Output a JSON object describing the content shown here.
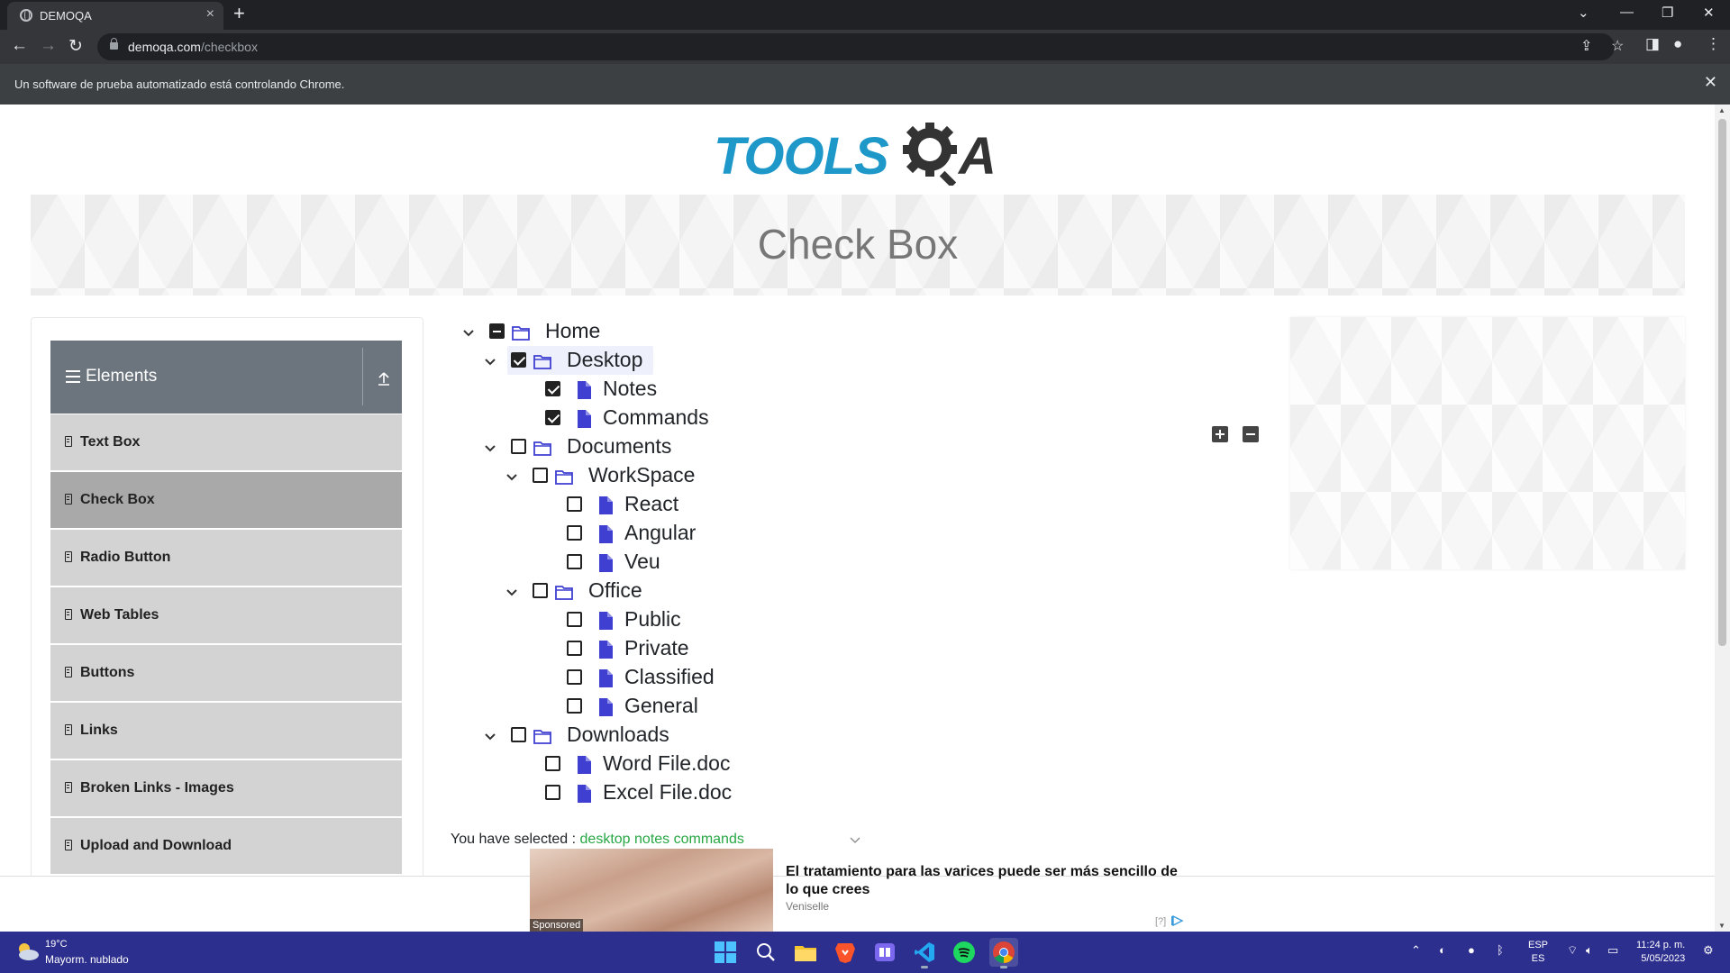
{
  "browser": {
    "tab_title": "DEMOQA",
    "tab_close": "×",
    "new_tab": "+",
    "url_host": "demoqa.com",
    "url_path": "/checkbox",
    "infobar_message": "Un software de prueba automatizado está controlando Chrome.",
    "infobar_close": "✕"
  },
  "site": {
    "logo_text_left": "TOOLS",
    "logo_text_right": "A",
    "page_title": "Check Box"
  },
  "sidebar": {
    "group_label": "Elements",
    "items": [
      {
        "label": "Text Box",
        "active": false
      },
      {
        "label": "Check Box",
        "active": true
      },
      {
        "label": "Radio Button",
        "active": false
      },
      {
        "label": "Web Tables",
        "active": false
      },
      {
        "label": "Buttons",
        "active": false
      },
      {
        "label": "Links",
        "active": false
      },
      {
        "label": "Broken Links - Images",
        "active": false
      },
      {
        "label": "Upload and Download",
        "active": false
      }
    ]
  },
  "tree": [
    {
      "label": "Home",
      "type": "folder",
      "state": "half",
      "expanded": true,
      "depth": 0
    },
    {
      "label": "Desktop",
      "type": "folder",
      "state": "checked",
      "expanded": true,
      "depth": 1,
      "highlighted": true
    },
    {
      "label": "Notes",
      "type": "file",
      "state": "checked",
      "depth": 2
    },
    {
      "label": "Commands",
      "type": "file",
      "state": "checked",
      "depth": 2
    },
    {
      "label": "Documents",
      "type": "folder",
      "state": "unchecked",
      "expanded": true,
      "depth": 1
    },
    {
      "label": "WorkSpace",
      "type": "folder",
      "state": "unchecked",
      "expanded": true,
      "depth": 2
    },
    {
      "label": "React",
      "type": "file",
      "state": "unchecked",
      "depth": 3
    },
    {
      "label": "Angular",
      "type": "file",
      "state": "unchecked",
      "depth": 3
    },
    {
      "label": "Veu",
      "type": "file",
      "state": "unchecked",
      "depth": 3
    },
    {
      "label": "Office",
      "type": "folder",
      "state": "unchecked",
      "expanded": true,
      "depth": 2
    },
    {
      "label": "Public",
      "type": "file",
      "state": "unchecked",
      "depth": 3
    },
    {
      "label": "Private",
      "type": "file",
      "state": "unchecked",
      "depth": 3
    },
    {
      "label": "Classified",
      "type": "file",
      "state": "unchecked",
      "depth": 3
    },
    {
      "label": "General",
      "type": "file",
      "state": "unchecked",
      "depth": 3
    },
    {
      "label": "Downloads",
      "type": "folder",
      "state": "unchecked",
      "expanded": true,
      "depth": 1
    },
    {
      "label": "Word File.doc",
      "type": "file",
      "state": "unchecked",
      "depth": 2
    },
    {
      "label": "Excel File.doc",
      "type": "file",
      "state": "unchecked",
      "depth": 2
    }
  ],
  "result": {
    "prefix": "You have selected :",
    "selected": "desktop notes commands"
  },
  "ad": {
    "sponsored_label": "Sponsored",
    "headline": "El tratamiento para las varices puede ser más sencillo de lo que crees",
    "brand": "Veniselle",
    "info": "[?]"
  },
  "taskbar": {
    "weather_temp": "19°C",
    "weather_desc": "Mayorm. nublado",
    "lang_line1": "ESP",
    "lang_line2": "ES",
    "time": "11:24 p. m.",
    "date": "5/05/2023"
  },
  "colors": {
    "file_icon": "#3f3fd1",
    "folder_icon": "#3f3fd1",
    "selected_text": "#28a745",
    "sidebar_header": "#6c757d",
    "sidebar_item": "#d3d3d3",
    "sidebar_item_active": "#a9a9a9",
    "taskbar": "#2d2f8e"
  }
}
